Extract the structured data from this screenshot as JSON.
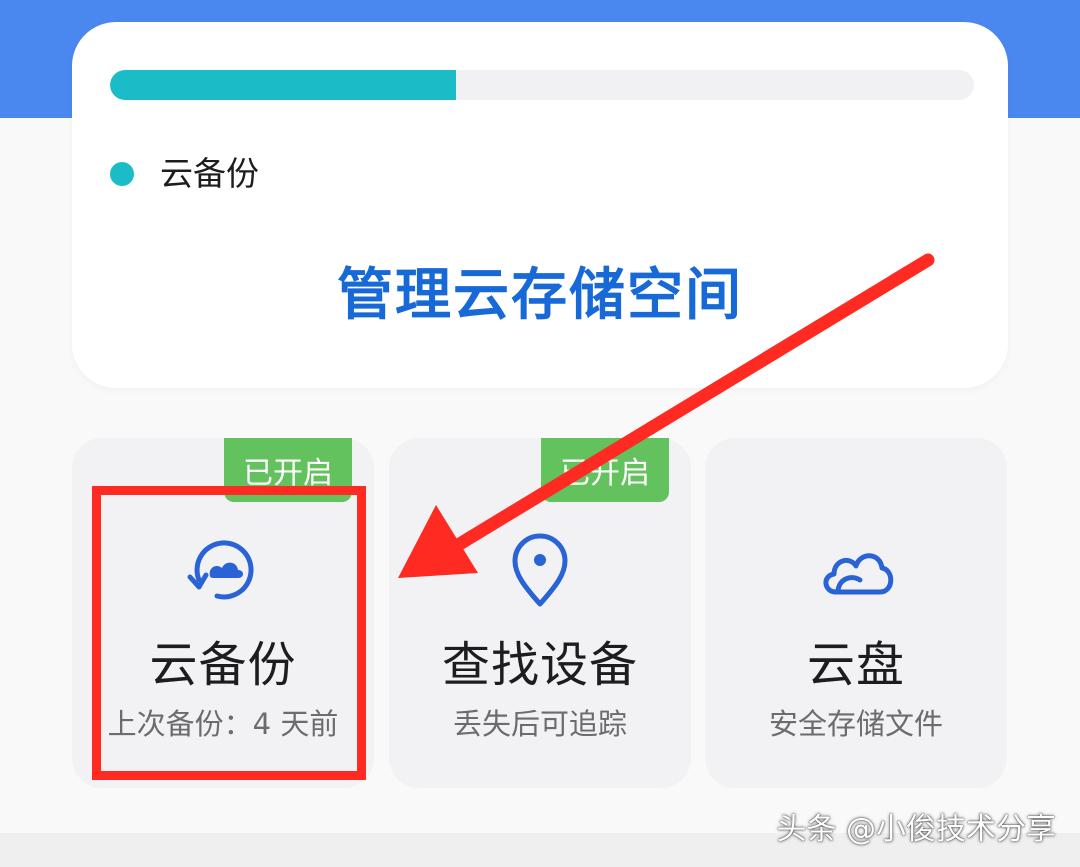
{
  "storage": {
    "used_fraction": 0.4,
    "legend_label": "云备份",
    "manage_link": "管理云存储空间",
    "fill_color": "#1bbcc8",
    "link_color": "#1769d8"
  },
  "cards": [
    {
      "icon": "cloud-backup-icon",
      "title": "云备份",
      "subtitle": "上次备份：4 天前",
      "status": "已开启"
    },
    {
      "icon": "location-pin-icon",
      "title": "查找设备",
      "subtitle": "丢失后可追踪",
      "status": "已开启"
    },
    {
      "icon": "cloud-drive-icon",
      "title": "云盘",
      "subtitle": "安全存储文件"
    }
  ],
  "annotation": {
    "highlight_color": "#ff2a22",
    "status_color": "#63c25d"
  },
  "watermark": "头条 @小俊技术分享"
}
